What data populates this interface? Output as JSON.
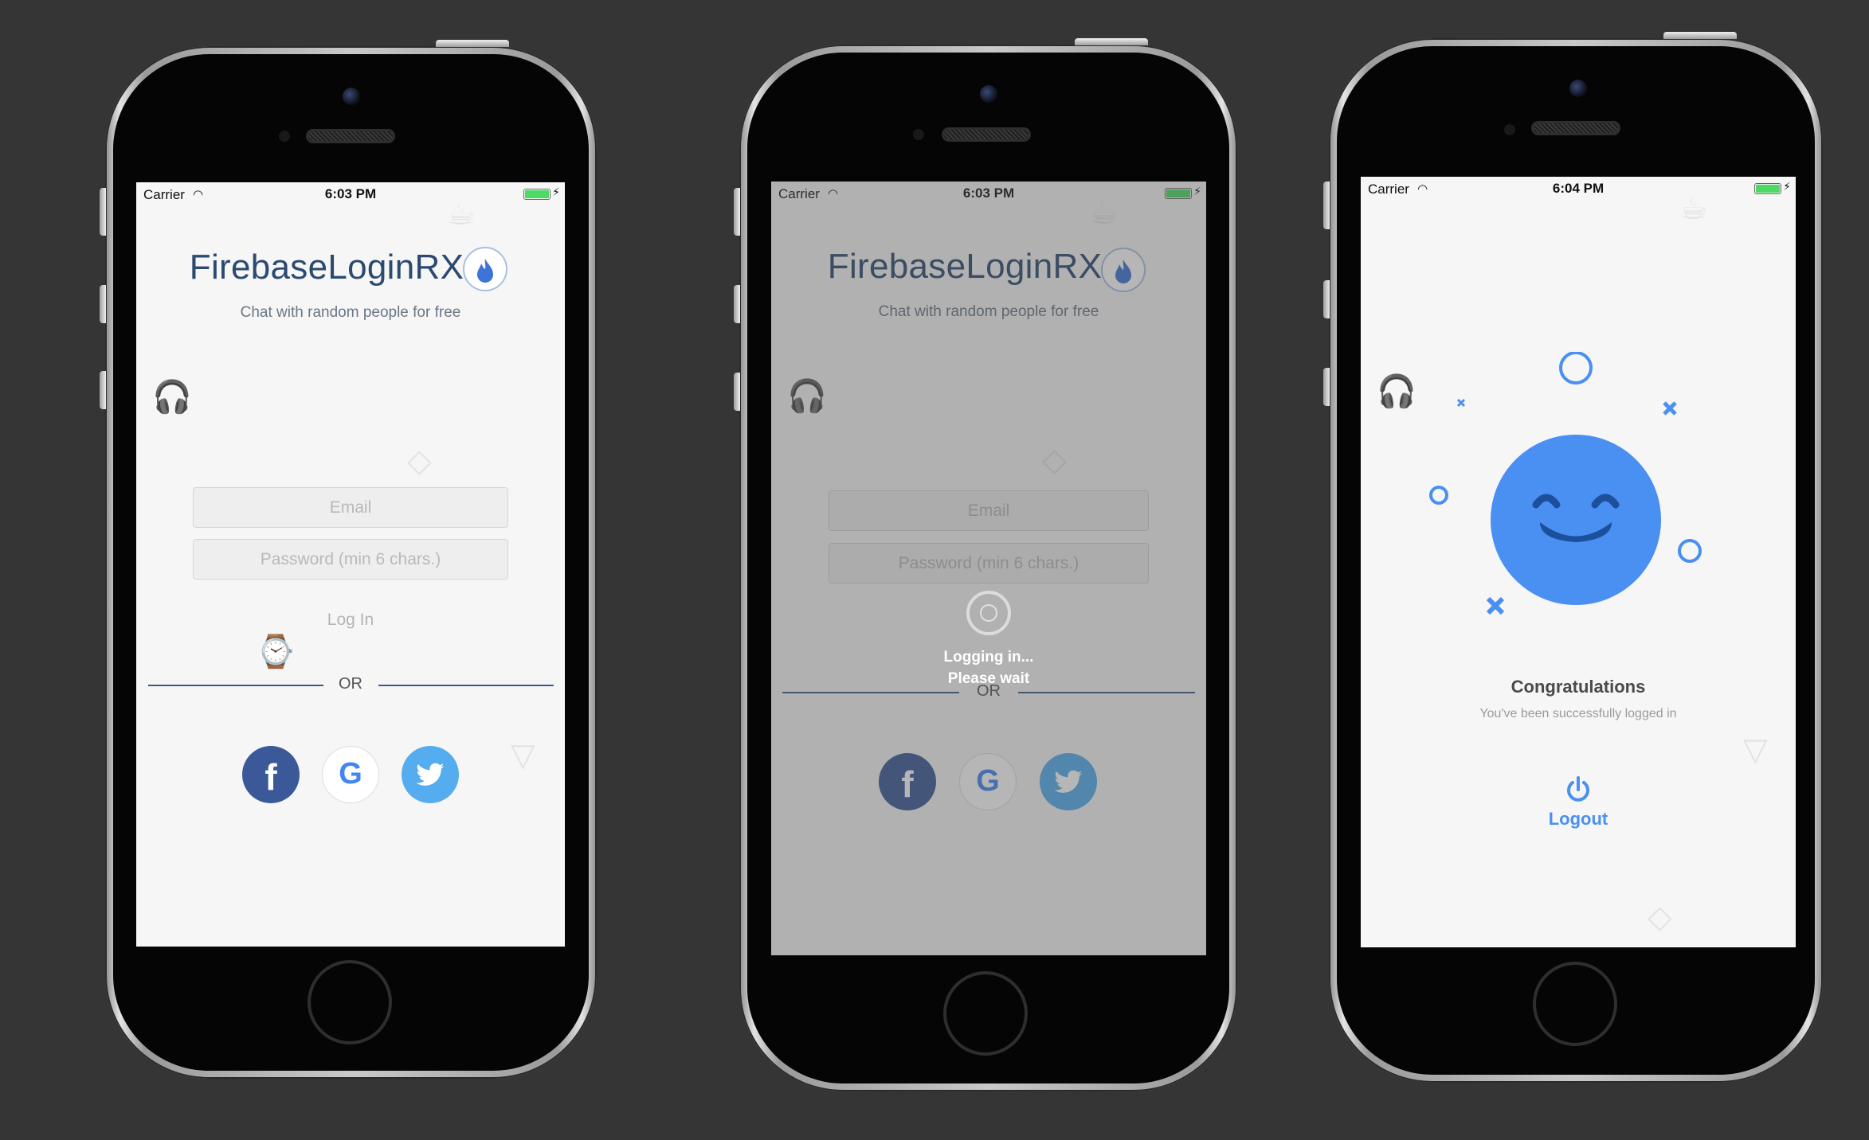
{
  "screens": [
    {
      "status": {
        "carrier": "Carrier",
        "time": "6:03 PM"
      },
      "title": "FirebaseLoginRX",
      "subtitle": "Chat with random people for free",
      "email_placeholder": "Email",
      "password_placeholder": "Password (min 6 chars.)",
      "login_label": "Log In",
      "or_label": "OR",
      "social": {
        "facebook": "f",
        "google": "G"
      }
    },
    {
      "status": {
        "carrier": "Carrier",
        "time": "6:03 PM"
      },
      "title": "FirebaseLoginRX",
      "subtitle": "Chat with random people for free",
      "email_placeholder": "Email",
      "password_placeholder": "Password (min 6 chars.)",
      "or_label": "OR",
      "loading_line1": "Logging in...",
      "loading_line2": "Please wait",
      "social": {
        "facebook": "f",
        "google": "G"
      }
    },
    {
      "status": {
        "carrier": "Carrier",
        "time": "6:04 PM"
      },
      "congrats_title": "Congratulations",
      "congrats_subtitle": "You've been successfully logged in",
      "logout_label": "Logout"
    }
  ],
  "colors": {
    "accent_blue": "#4a8ff2",
    "title_navy": "#2c4a70",
    "facebook": "#3b5998",
    "twitter": "#55acee",
    "battery": "#4cd964"
  },
  "icons": [
    "wifi-icon",
    "battery-icon",
    "flame-icon",
    "facebook-icon",
    "google-icon",
    "twitter-icon",
    "spinner-icon",
    "smiley-face-icon",
    "power-icon"
  ]
}
